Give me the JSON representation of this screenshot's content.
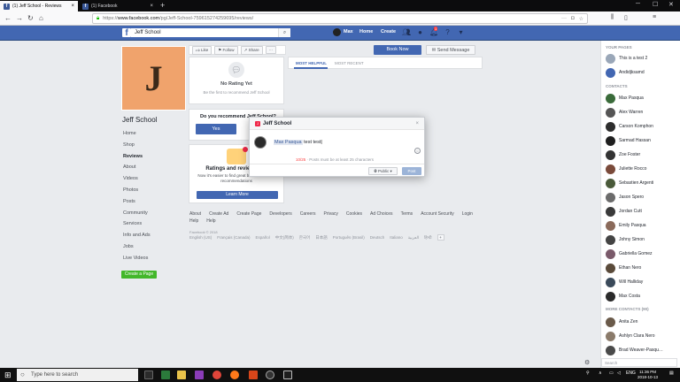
{
  "browser": {
    "tabs": [
      {
        "label": "(1) Jeff School - Reviews",
        "active": true
      },
      {
        "label": "(1) Facebook",
        "active": false
      }
    ],
    "new_tab": "+",
    "url": {
      "proto": "https://",
      "host": "www.facebook.com",
      "path": "/pg/Jeff-School-759615274259695/reviews/"
    }
  },
  "fb_header": {
    "logo": "f",
    "search_value": "Jeff School",
    "user_name": "Max",
    "home": "Home",
    "create": "Create"
  },
  "page": {
    "initial": "J",
    "name": "Jeff School",
    "nav": [
      "Home",
      "Shop",
      "Reviews",
      "About",
      "Videos",
      "Photos",
      "Posts",
      "Community",
      "Services",
      "Info and Ads",
      "Jobs",
      "Live Videos"
    ],
    "active_nav": "Reviews",
    "create_page": "Create a Page",
    "actions": {
      "like": "Like",
      "follow": "Follow",
      "share": "Share",
      "more": "···"
    },
    "book_now": "Book Now",
    "send_message": "Send Message"
  },
  "rating": {
    "title": "No Rating Yet",
    "subtitle": "Be the first to recommend Jeff School"
  },
  "review_tabs": {
    "most_helpful": "MOST HELPFUL",
    "most_recent": "MOST RECENT"
  },
  "recommend": {
    "question": "Do you recommend Jeff School?",
    "yes": "Yes"
  },
  "ratings_card": {
    "title": "Ratings and reviews h…",
    "subtitle": "Now it's easier to find great businesses with recommendations",
    "learn_more": "Learn More"
  },
  "footer": {
    "links": [
      "About",
      "Create Ad",
      "Create Page",
      "Developers",
      "Careers",
      "Privacy",
      "Cookies",
      "Ad Choices",
      "Terms",
      "Account Security",
      "Login Help",
      "Help"
    ],
    "copyright": "Facebook © 2018",
    "languages": [
      "English (US)",
      "Français (Canada)",
      "Español",
      "中文(简体)",
      "한국어",
      "日本語",
      "Português (Brasil)",
      "Deutsch",
      "Italiano",
      "العربية",
      "हिन्दी"
    ],
    "more": "+"
  },
  "dialog": {
    "title": "Jeff School",
    "close": "×",
    "tag": "Max Pasqua",
    "text": " test test",
    "count": "10/25",
    "count_hint": " · Posts must be at least 25 characters",
    "privacy": "Public ▾",
    "post": "Post"
  },
  "chat": {
    "your_pages_header": "YOUR PAGES",
    "pages": [
      "This is a test 2",
      "Andidjksamd"
    ],
    "contacts_header": "CONTACTS",
    "contacts": [
      {
        "name": "Max Pasqua",
        "color": "#3a6b3a"
      },
      {
        "name": "Alex Warren",
        "color": "#555555"
      },
      {
        "name": "Carson Komphon",
        "color": "#2d2d2d"
      },
      {
        "name": "Sarmad Hassan",
        "color": "#1f1f1f"
      },
      {
        "name": "Zoe Foster",
        "color": "#333333"
      },
      {
        "name": "Juliette Rocco",
        "color": "#7a4a3a"
      },
      {
        "name": "Sebastien Argenti",
        "color": "#4a5a3a"
      },
      {
        "name": "Jason Spero",
        "color": "#6b6b6b"
      },
      {
        "name": "Jordan Cutt",
        "color": "#3a3a3a"
      },
      {
        "name": "Emily Pasqua",
        "color": "#8a6a5a"
      },
      {
        "name": "Johny Simon",
        "color": "#444444"
      },
      {
        "name": "Gabriella Gomez",
        "color": "#7a5a6a"
      },
      {
        "name": "Ethan Nero",
        "color": "#5a4a3a"
      },
      {
        "name": "Will Halliday",
        "color": "#3a4a5a"
      },
      {
        "name": "Max Costa",
        "color": "#2a2a2a"
      }
    ],
    "more_contacts_header": "MORE CONTACTS (90)",
    "more_contacts": [
      {
        "name": "Anita Zen",
        "color": "#6a5a4a"
      },
      {
        "name": "Ashlyn Clara Nero",
        "color": "#8a7a6a"
      },
      {
        "name": "Brad Weaver-Pasqu…",
        "color": "#4a4a4a"
      }
    ],
    "search_placeholder": "Search"
  },
  "taskbar": {
    "search_placeholder": "Type here to search",
    "tray_lang": "ENG",
    "time": "11:36 PM",
    "date": "2018-10-13"
  }
}
